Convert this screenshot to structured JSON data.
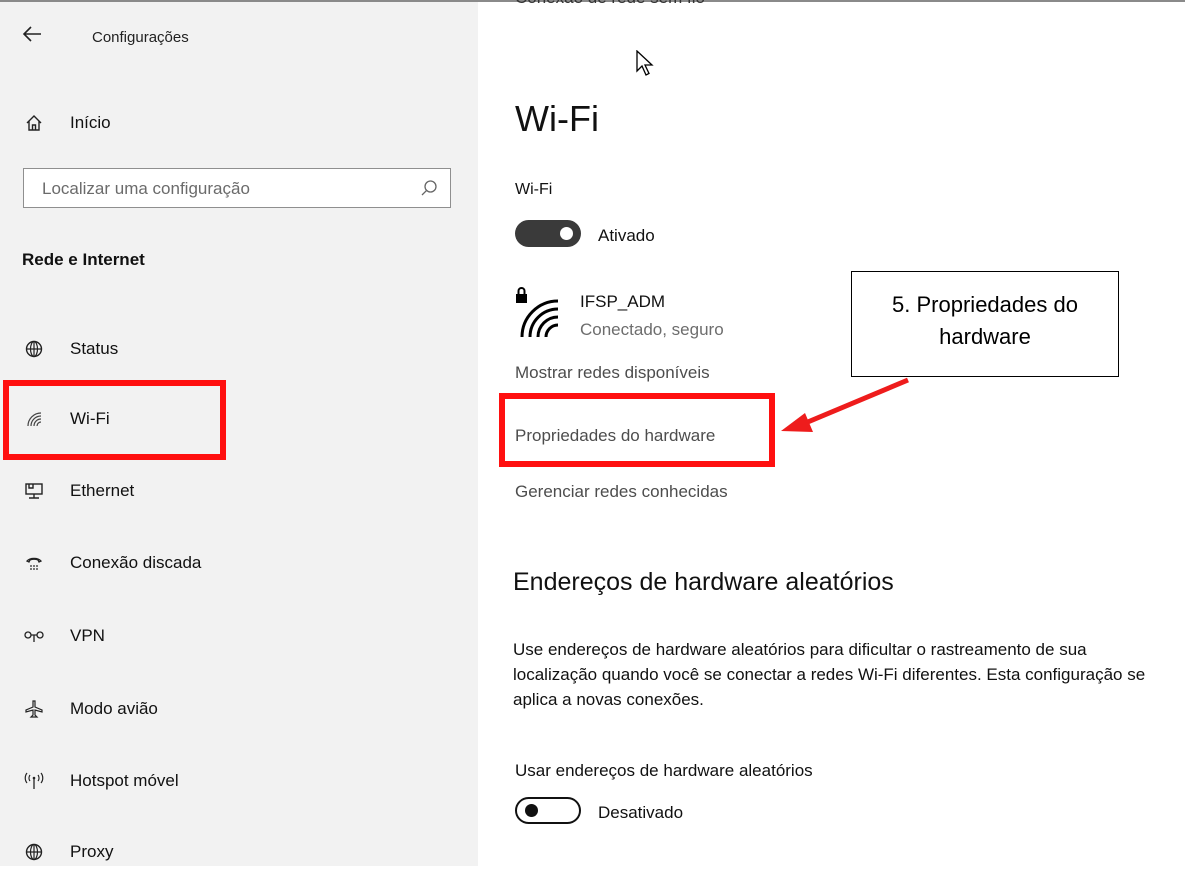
{
  "window": {
    "title": "Configurações",
    "cut_heading": "Conexão de rede sem fio"
  },
  "sidebar": {
    "home_label": "Início",
    "search_placeholder": "Localizar uma configuração",
    "section": "Rede e Internet",
    "items": [
      {
        "label": "Status",
        "icon": "globe-icon"
      },
      {
        "label": "Wi-Fi",
        "icon": "wifi-icon"
      },
      {
        "label": "Ethernet",
        "icon": "ethernet-icon"
      },
      {
        "label": "Conexão discada",
        "icon": "dialup-icon"
      },
      {
        "label": "VPN",
        "icon": "vpn-icon"
      },
      {
        "label": "Modo avião",
        "icon": "airplane-icon"
      },
      {
        "label": "Hotspot móvel",
        "icon": "hotspot-icon"
      },
      {
        "label": "Proxy",
        "icon": "proxy-globe-icon"
      }
    ]
  },
  "main": {
    "title": "Wi-Fi",
    "wifi_label": "Wi-Fi",
    "wifi_toggle_state": "Ativado",
    "network": {
      "name": "IFSP_ADM",
      "status": "Conectado, seguro"
    },
    "links": {
      "show_networks": "Mostrar redes disponíveis",
      "hardware_properties": "Propriedades do hardware",
      "manage_networks": "Gerenciar redes conhecidas"
    },
    "random_hw": {
      "heading": "Endereços de hardware aleatórios",
      "description": "Use endereços de hardware aleatórios para dificultar o rastreamento de sua localização quando você se conectar a redes Wi-Fi diferentes. Esta configuração se aplica a novas conexões.",
      "toggle_label": "Usar endereços de hardware aleatórios",
      "toggle_state": "Desativado"
    }
  },
  "annotation": {
    "callout_line1": "5. Propriedades do",
    "callout_line2": "hardware",
    "highlight_color": "#ff1010"
  }
}
